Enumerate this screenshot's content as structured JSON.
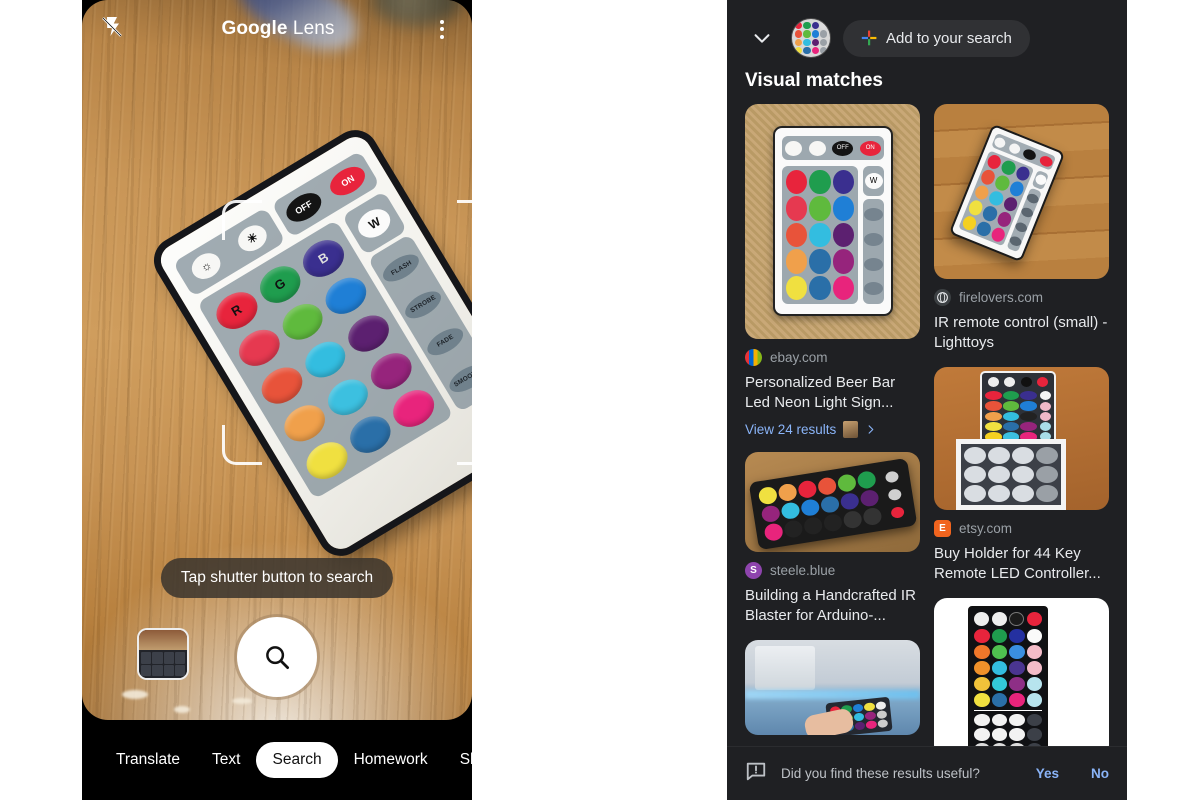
{
  "left_panel": {
    "topbar": {
      "flash_icon": "flash-off-icon",
      "title_bold": "Google",
      "title_light": "Lens",
      "menu_icon": "overflow-menu-icon"
    },
    "viewfinder": {
      "hint": "Tap shutter button to search",
      "shutter_icon": "search-icon",
      "gallery_icon": "gallery-thumbnail",
      "subject": "IR RGB LED remote control on wooden table",
      "remote": {
        "brightness_up_icon": "brightness-up-icon",
        "brightness_down_icon": "brightness-down-icon",
        "off_label": "OFF",
        "on_label": "ON",
        "white_label": "W",
        "rgb_labels": [
          "R",
          "G",
          "B"
        ],
        "effects": [
          "FLASH",
          "STROBE",
          "FADE",
          "SMOOTH"
        ],
        "color_rows": [
          [
            "#e8243c",
            "#1f9d4e",
            "#3a2f8f"
          ],
          [
            "#e63950",
            "#5fba3d",
            "#1f7fd6"
          ],
          [
            "#e8533a",
            "#33bde0",
            "#5c2070"
          ],
          [
            "#f0a04b",
            "#3cc0e0",
            "#96247c"
          ],
          [
            "#f0e040",
            "#2a6fa8",
            "#e8247c"
          ]
        ]
      }
    },
    "nav": {
      "items": [
        {
          "label": "Translate",
          "active": false
        },
        {
          "label": "Text",
          "active": false
        },
        {
          "label": "Search",
          "active": true
        },
        {
          "label": "Homework",
          "active": false
        },
        {
          "label": "Shopping",
          "active": false
        }
      ]
    }
  },
  "right_panel": {
    "header": {
      "collapse_icon": "chevron-down-icon",
      "avatar_alt": "query-thumbnail-avatar",
      "add_icon": "google-plus-icon",
      "add_label": "Add to your search"
    },
    "section_title": "Visual matches",
    "results": [
      {
        "source": "ebay.com",
        "favicon_kind": "ebay",
        "title": "Personalized Beer Bar Led Neon Light Sign...",
        "view_more": "View 24 results",
        "image_alt": "RGB remote on burlap background"
      },
      {
        "source": "firelovers.com",
        "favicon_kind": "globe",
        "title": "IR remote control (small) - Lighttoys",
        "view_more": "",
        "image_alt": "Tilted white remote on wood planks"
      },
      {
        "source": "steele.blue",
        "favicon_kind": "steele",
        "title": "Building a Handcrafted IR Blaster for Arduino-...",
        "view_more": "",
        "image_alt": "Dark RGB remote angled on wooden table"
      },
      {
        "source": "etsy.com",
        "favicon_kind": "etsy",
        "title": "Buy Holder for 44 Key Remote LED Controller...",
        "view_more": "",
        "image_alt": "Two remotes on wooden surface with holder"
      },
      {
        "source": "",
        "favicon_kind": "",
        "title": "",
        "view_more": "",
        "image_alt": "Hand holding remote under LED strip light"
      },
      {
        "source": "",
        "favicon_kind": "",
        "title": "",
        "view_more": "",
        "image_alt": "44 key black RGB remote on white background"
      }
    ],
    "feedback": {
      "icon": "feedback-icon",
      "question": "Did you find these results useful?",
      "yes_label": "Yes",
      "no_label": "No"
    }
  },
  "colors": {
    "panel_bg": "#1f2023",
    "link_blue": "#8ab4f8",
    "muted_text": "#9aa0a6",
    "accent_red": "#e8243c"
  }
}
